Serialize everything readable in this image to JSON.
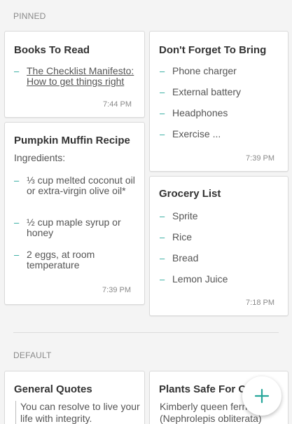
{
  "sections": {
    "pinned": "PINNED",
    "default": "DEFAULT"
  },
  "notes": {
    "books": {
      "title": "Books To Read",
      "items": [
        "The Checklist Manifesto: How to get things right"
      ],
      "time": "7:44 PM"
    },
    "pumpkin": {
      "title": "Pumpkin Muffin Recipe",
      "subtitle": "Ingredients:",
      "items": [
        "⅓ cup melted coconut oil or extra-virgin olive oil*",
        "½ cup maple syrup or honey",
        "2 eggs, at room temperature"
      ],
      "time": "7:39 PM"
    },
    "bring": {
      "title": "Don't Forget To Bring",
      "items": [
        "Phone charger",
        "External battery",
        "Headphones",
        "Exercise ..."
      ],
      "time": "7:39 PM"
    },
    "grocery": {
      "title": "Grocery List",
      "items": [
        "Sprite",
        "Rice",
        "Bread",
        "Lemon Juice"
      ],
      "time": "7:18 PM"
    },
    "quotes": {
      "title": "General Quotes",
      "text": "You can resolve to live your life with integrity."
    },
    "plants": {
      "title": "Plants Safe For C",
      "text": "Kimberly queen fern (Nephrolepis obliterata)"
    }
  },
  "fab": {
    "icon": "plus-icon"
  },
  "colors": {
    "accent": "#26a69a",
    "background": "#f4f4f4"
  }
}
